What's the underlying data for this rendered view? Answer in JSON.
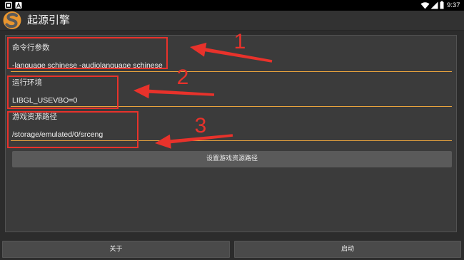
{
  "status_bar": {
    "time": "9:37",
    "left_icons": [
      "square-notification-icon",
      "letter-a-notification-icon"
    ],
    "right_icons": [
      "wifi-icon",
      "signal-icon",
      "battery-icon"
    ]
  },
  "app_bar": {
    "title": "起源引擎",
    "logo": "source-engine-logo"
  },
  "form": {
    "fields": [
      {
        "label": "命令行参数",
        "value": "-language schinese -audiolanguage schinese"
      },
      {
        "label": "运行环境",
        "value": "LIBGL_USEVBO=0"
      },
      {
        "label": "游戏资源路径",
        "value": "/storage/emulated/0/srceng"
      }
    ],
    "set_path_button": "设置游戏资源路径"
  },
  "bottom_bar": {
    "about_button": "关于",
    "launch_button": "启动"
  },
  "annotations": {
    "numbers": [
      "1",
      "2",
      "3"
    ]
  },
  "colors": {
    "status_bar": "#000000",
    "app_bar": "#323232",
    "background": "#2c2c2c",
    "panel": "#3b3b3b",
    "accent_underline": "#e8a33d",
    "button": "#5a5a5a",
    "bottom_button": "#4a4a4a",
    "annotation": "#e8322b",
    "logo_orange": "#e9962f"
  }
}
